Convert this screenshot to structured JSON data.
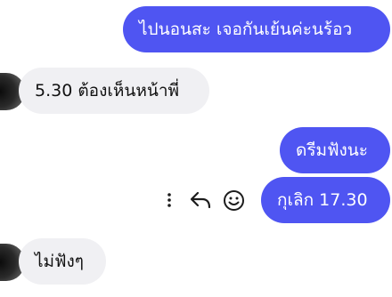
{
  "messages": [
    {
      "sender": "me",
      "text": "ไปนอนสะ เจอกันเย้นค่ะนร้อว"
    },
    {
      "sender": "them",
      "text": "5.30 ต้องเห็นหน้าพี่"
    },
    {
      "sender": "me",
      "text": "ดรีมฟังนะ"
    },
    {
      "sender": "me",
      "text": "กุเลิก 17.30"
    },
    {
      "sender": "them",
      "text": "ไม่ฟังๆ"
    }
  ],
  "message_actions": {
    "more_icon": "more-vertical-icon",
    "reply_icon": "reply-arrow-icon",
    "react_icon": "smiley-face-icon"
  },
  "colors": {
    "outgoing_bubble": "#4f55f2",
    "incoming_bubble": "#f0f0f3",
    "outgoing_text": "#ffffff",
    "incoming_text": "#111111",
    "action_icons": "#1c1c1c"
  }
}
